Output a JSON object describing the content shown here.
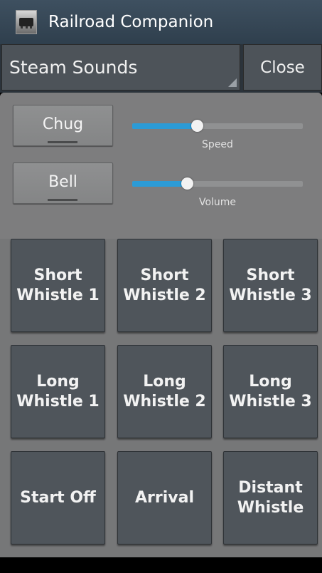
{
  "app": {
    "title": "Railroad Companion",
    "icon": "locomotive-photo-icon"
  },
  "spinner": {
    "selected": "Steam Sounds"
  },
  "close_label": "Close",
  "toggles": [
    {
      "label": "Chug"
    },
    {
      "label": "Bell"
    }
  ],
  "sliders": [
    {
      "label": "Speed",
      "value": 0.38
    },
    {
      "label": "Volume",
      "value": 0.32
    }
  ],
  "buttons": [
    {
      "label": "Short\nWhistle 1"
    },
    {
      "label": "Short\nWhistle 2"
    },
    {
      "label": "Short\nWhistle 3"
    },
    {
      "label": "Long\nWhistle 1"
    },
    {
      "label": "Long\nWhistle 2"
    },
    {
      "label": "Long\nWhistle 3"
    },
    {
      "label": "Start Off"
    },
    {
      "label": "Arrival"
    },
    {
      "label": "Distant\nWhistle"
    }
  ],
  "colors": {
    "accent": "#2c9bd6",
    "title_bar": "#3e5060",
    "button": "#4f555b"
  }
}
